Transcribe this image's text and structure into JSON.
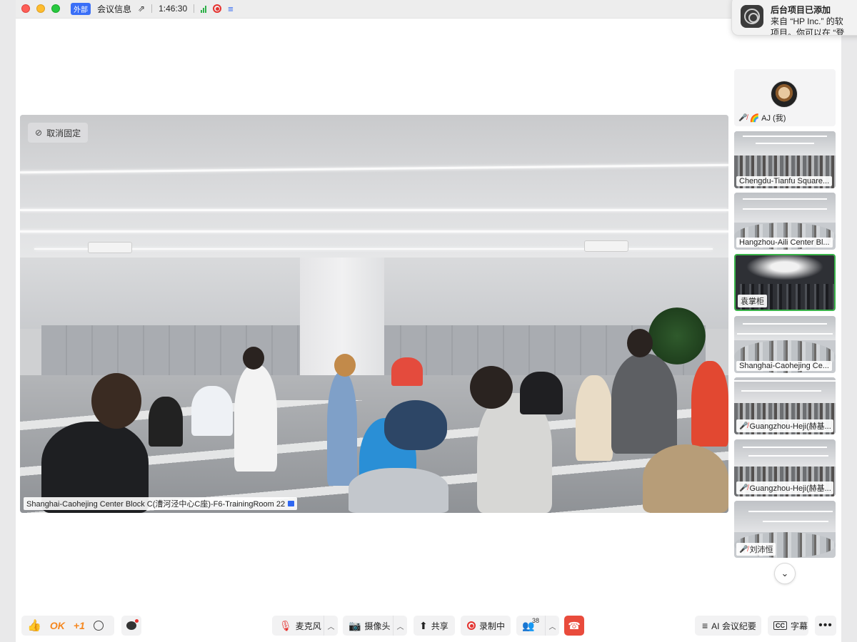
{
  "titlebar": {
    "external_badge": "外部",
    "meeting_info": "会议信息",
    "share_icon": "share-icon",
    "timer": "1:46:30",
    "signal_icon": "signal-icon",
    "recording_icon": "recording-icon",
    "list_icon": "list-icon"
  },
  "notification": {
    "title": "后台项目已添加",
    "line1": "来自 “HP Inc.” 的软",
    "line2": "项目。你可以在 “登"
  },
  "main_video": {
    "unpin_label": "取消固定",
    "caption": "Shanghai-Caohejing Center Block C(漕河泾中心C座)-F6-TrainingRoom 22"
  },
  "participants": [
    {
      "label": "AJ (我)",
      "prefix": "🌈",
      "muted": true
    },
    {
      "label": "Chengdu-Tianfu Square...",
      "muted": false
    },
    {
      "label": "Hangzhou-Aili Center Bl...",
      "muted": false
    },
    {
      "label": "袁掌柜",
      "muted": false,
      "active": true
    },
    {
      "label": "Shanghai-Caohejing Ce...",
      "muted": false
    },
    {
      "label": "Guangzhou-Heji(赫基...",
      "muted": true
    },
    {
      "label": "Guangzhou-Heji(赫基...",
      "muted": true
    },
    {
      "label": "刘沛恒",
      "muted": true
    }
  ],
  "toolbar": {
    "reaction_ok": "OK",
    "reaction_plus": "+1",
    "mic_label": "麦克风",
    "camera_label": "摄像头",
    "share_label": "共享",
    "record_label": "录制中",
    "participant_count": "38",
    "ai_label": "AI 会议纪要",
    "subtitle_label": "字幕",
    "more_label": "•••"
  },
  "colors": {
    "accent": "#2f67f2",
    "danger": "#e94b3c",
    "active_border": "#3ab44a",
    "reaction": "#f5871f"
  }
}
